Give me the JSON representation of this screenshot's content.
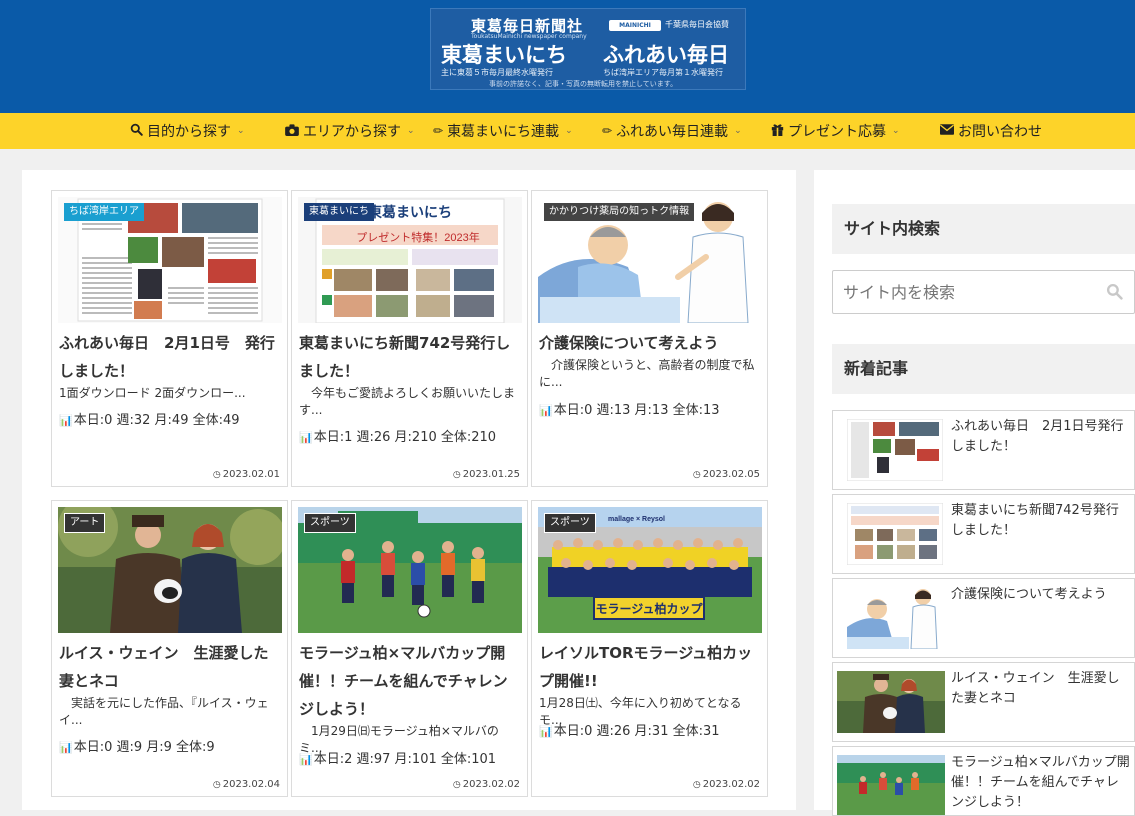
{
  "header": {
    "company": "東葛毎日新聞社",
    "company_en": "ToukatsuMainichi newspaper company",
    "mainichi_logo": "MAINICHI",
    "sponsor": "千葉県毎日会協賛",
    "title1": "東葛まいにち",
    "title2": "ふれあい毎日",
    "sub1": "主に東葛５市毎月最終水曜発行",
    "sub2": "ちば湾岸エリア毎月第１水曜発行",
    "notice": "事前の許諾なく、記事・写真の無断転用を禁止しています。"
  },
  "nav": {
    "items": [
      {
        "icon": "search-icon",
        "label": "目的から探す",
        "chevron": true
      },
      {
        "icon": "camera-icon",
        "label": "エリアから探す",
        "chevron": true
      },
      {
        "icon": "pencil-icon",
        "label": "東葛まいにち連載",
        "chevron": true
      },
      {
        "icon": "pencil-icon",
        "label": "ふれあい毎日連載",
        "chevron": true
      },
      {
        "icon": "gift-icon",
        "label": "プレゼント応募",
        "chevron": true
      },
      {
        "icon": "envelope-icon",
        "label": "お問い合わせ",
        "chevron": false
      }
    ]
  },
  "cards": [
    {
      "category": "ちば湾岸エリア",
      "category_color": "#1a9fd0",
      "title": "ふれあい毎日　2月1日号　発行しました！",
      "snippet": "1面ダウンロード 2面ダウンロー...",
      "stats": "本日:0 週:32 月:49 全体:49",
      "date": "2023.02.01"
    },
    {
      "category": "東葛まいにち",
      "category_color": "#1b3f7a",
      "title": "東葛まいにち新聞742号発行しました！",
      "snippet": "　今年もご愛読よろしくお願いいたします...",
      "stats": "本日:1 週:26 月:210 全体:210",
      "date": "2023.01.25"
    },
    {
      "category": "かかりつけ薬局の知っトク情報",
      "category_color": "#444444",
      "title": "介護保険について考えよう",
      "snippet": "　介護保険というと、高齢者の制度で私に...",
      "stats": "本日:0 週:13 月:13 全体:13",
      "date": "2023.02.05"
    },
    {
      "category": "アート",
      "category_color": "#333333",
      "title": "ルイス・ウェイン　生涯愛した妻とネコ",
      "snippet": "　実話を元にした作品、『ルイス・ウェイ...",
      "stats": "本日:0 週:9 月:9 全体:9",
      "date": "2023.02.04"
    },
    {
      "category": "スポーツ",
      "category_color": "#333333",
      "title": "モラージュ柏×マルバカップ開催！！チームを組んでチャレンジしよう！",
      "snippet": "　1月29日㈰モラージュ柏×マルバのミ...",
      "stats": "本日:2 週:97 月:101 全体:101",
      "date": "2023.02.02"
    },
    {
      "category": "スポーツ",
      "category_color": "#333333",
      "title": "レイソルTORモラージュ柏カップ開催!!",
      "snippet": "1月28日㈯、今年に入り初めてとなるモ...",
      "stats": "本日:0 週:26 月:31 全体:31",
      "date": "2023.02.02"
    }
  ],
  "sidebar": {
    "search_title": "サイト内検索",
    "search_placeholder": "サイト内を検索",
    "new_title": "新着記事",
    "new_items": [
      {
        "title": "ふれあい毎日　2月1日号発行しました！"
      },
      {
        "title": "東葛まいにち新聞742号発行しました！"
      },
      {
        "title": "介護保険について考えよう"
      },
      {
        "title": "ルイス・ウェイン　生涯愛した妻とネコ"
      },
      {
        "title": "モラージュ柏×マルバカップ開催！！チームを組んでチャレンジしよう！"
      }
    ]
  },
  "thumb_texts": {
    "tokatsu_header": "東葛まいにち",
    "present": "プレゼント特集！2023年",
    "moraju_banner": "モラージュ柏カップ",
    "moraju_logo": "mallage × Reysol"
  },
  "colors": {
    "header_bg": "#0a5aa8",
    "nav_bg": "#fdd329",
    "page_bg": "#f0f0f0"
  }
}
